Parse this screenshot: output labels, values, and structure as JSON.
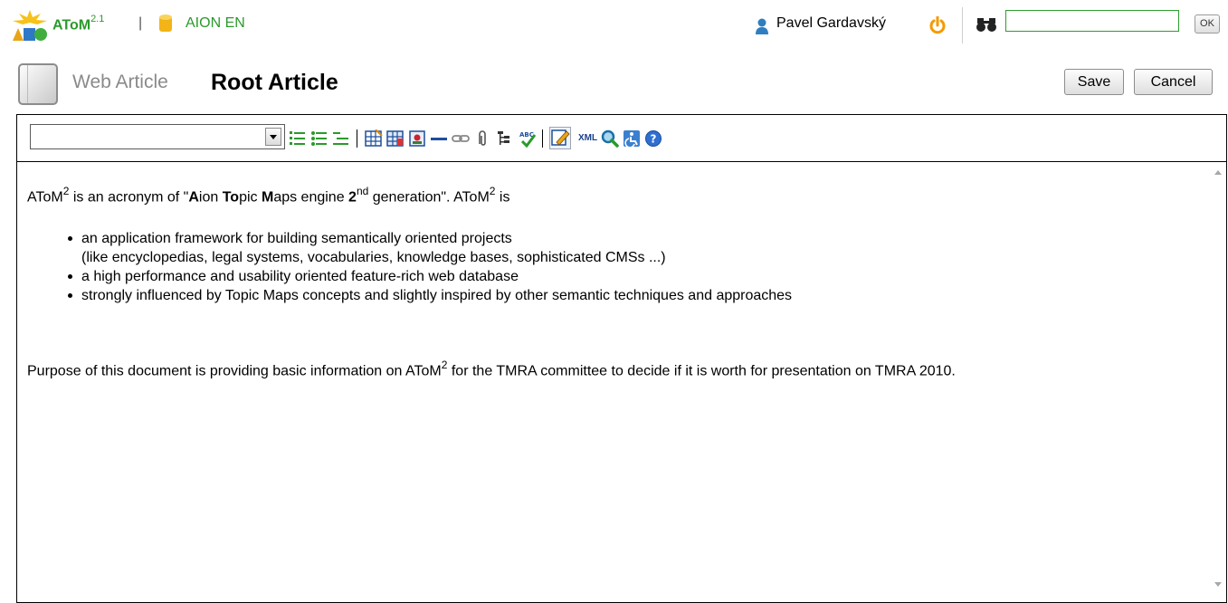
{
  "topbar": {
    "app_name": "AToM",
    "app_version": "2.1",
    "separator": "|",
    "database": "AION EN",
    "user_name": "Pavel Gardavský",
    "search_value": "",
    "search_button": "OK"
  },
  "header": {
    "doc_type": "Web Article",
    "title": "Root Article",
    "save_label": "Save",
    "cancel_label": "Cancel"
  },
  "toolbar": {
    "style_select_value": "",
    "xml_label": "XML",
    "icons": [
      "numbered-list-icon",
      "bulleted-list-icon",
      "outline-list-icon",
      "insert-table-icon",
      "table-properties-icon",
      "insert-image-icon",
      "horizontal-rule-icon",
      "link-icon",
      "attachment-icon",
      "tree-icon",
      "spellcheck-icon",
      "edit-icon",
      "xml-icon",
      "preview-icon",
      "accessibility-icon",
      "help-icon"
    ]
  },
  "content": {
    "p1_a": "AToM",
    "p1_sup": "2",
    "p1_b": " is an acronym of \"",
    "p1_A": "A",
    "p1_c": "ion  ",
    "p1_To": "To",
    "p1_d": "pic  ",
    "p1_M": "M",
    "p1_e": "aps engine  ",
    "p1_2": "2",
    "p1_nd": "nd",
    "p1_f": " generation\".  AToM",
    "p1_sup2": "2",
    "p1_g": " is",
    "bullets": [
      "an application framework for building semantically oriented projects",
      "(like encyclopedias, legal systems, vocabularies, knowledge bases, sophisticated CMSs ...)",
      "a high performance and usability oriented feature-rich web database",
      "strongly influenced by Topic Maps concepts and slightly inspired by other semantic techniques and approaches"
    ],
    "p2_a": "Purpose of this document is providing basic information on AToM",
    "p2_sup": "2",
    "p2_b": " for the TMRA committee to decide if it is worth for presentation on TMRA 2010."
  },
  "colors": {
    "brand_green": "#2b9a2b",
    "power_orange": "#f59a00",
    "search_border": "#2e9c2e"
  }
}
